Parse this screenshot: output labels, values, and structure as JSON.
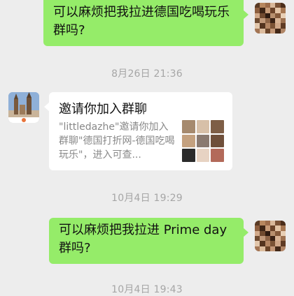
{
  "messages": {
    "m1_text": "可以麻烦把我拉进德国吃喝玩乐群吗?",
    "ts1": "8月26日 21:36",
    "card_title": "邀请你加入群聊",
    "card_desc": "\"littledazhe\"邀请你加入群聊\"德国打折网-德国吃喝玩乐\"，进入可查...",
    "ts2": "10月4日 19:29",
    "m2_text": "可以麻烦把我拉进 Prime day 群吗?",
    "ts3": "10月4日 19:43"
  },
  "colors": {
    "bubble_out": "#95ec69",
    "background": "#ededed",
    "timestamp": "#a6a6a6"
  }
}
